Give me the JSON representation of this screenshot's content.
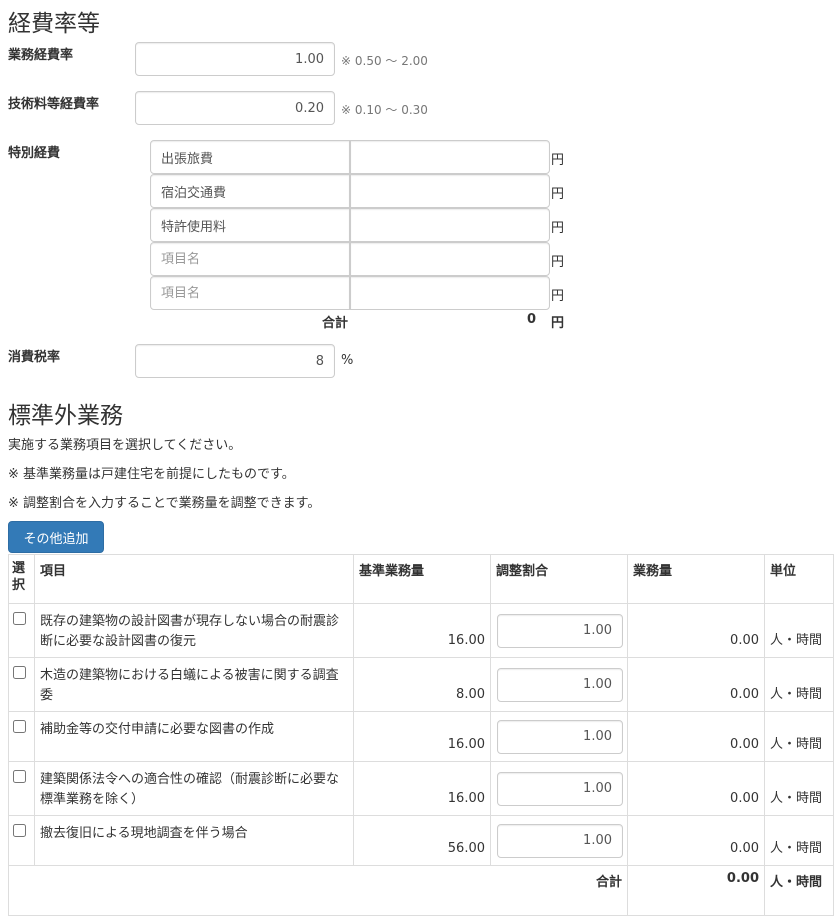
{
  "section1": {
    "title": "経費率等"
  },
  "gyomu": {
    "label": "業務経費率",
    "value": "1.00",
    "hint": "※ 0.50 〜 2.00"
  },
  "gijutsu": {
    "label": "技術料等経費率",
    "value": "0.20",
    "hint": "※ 0.10 〜 0.30"
  },
  "tokubetsu": {
    "label": "特別経費",
    "items": [
      {
        "name": "出張旅費",
        "placeholder": "",
        "amount": "",
        "unit": "円"
      },
      {
        "name": "宿泊交通費",
        "placeholder": "",
        "amount": "",
        "unit": "円"
      },
      {
        "name": "特許使用料",
        "placeholder": "",
        "amount": "",
        "unit": "円"
      },
      {
        "name": "",
        "placeholder": "項目名",
        "amount": "",
        "unit": "円"
      },
      {
        "name": "",
        "placeholder": "項目名",
        "amount": "",
        "unit": "円"
      }
    ],
    "total_label": "合計",
    "total_value": "0",
    "total_unit": "円"
  },
  "tax": {
    "label": "消費税率",
    "value": "8",
    "unit": "%"
  },
  "section2": {
    "title": "標準外業務",
    "line1": "実施する業務項目を選択してください。",
    "line2": "※ 基準業務量は戸建住宅を前提にしたものです。",
    "line3": "※ 調整割合を入力することで業務量を調整できます。",
    "add_button": "その他追加"
  },
  "table": {
    "headers": {
      "select": "選択",
      "item": "項目",
      "base": "基準業務量",
      "ratio": "調整割合",
      "amount": "業務量",
      "unit": "単位"
    },
    "rows": [
      {
        "checked": false,
        "item": "既存の建築物の設計図書が現存しない場合の耐震診断に必要な設計図書の復元",
        "base": "16.00",
        "ratio": "1.00",
        "amount": "0.00",
        "unit": "人・時間"
      },
      {
        "checked": false,
        "item": "木造の建築物における白蟻による被害に関する調査委",
        "base": "8.00",
        "ratio": "1.00",
        "amount": "0.00",
        "unit": "人・時間"
      },
      {
        "checked": false,
        "item": "補助金等の交付申請に必要な図書の作成",
        "base": "16.00",
        "ratio": "1.00",
        "amount": "0.00",
        "unit": "人・時間"
      },
      {
        "checked": false,
        "item": "建築関係法令への適合性の確認（耐震診断に必要な標準業務を除く）",
        "base": "16.00",
        "ratio": "1.00",
        "amount": "0.00",
        "unit": "人・時間"
      },
      {
        "checked": false,
        "item": "撤去復旧による現地調査を伴う場合",
        "base": "56.00",
        "ratio": "1.00",
        "amount": "0.00",
        "unit": "人・時間"
      }
    ],
    "total_label": "合計",
    "total_value": "0.00",
    "total_unit": "人・時間"
  }
}
